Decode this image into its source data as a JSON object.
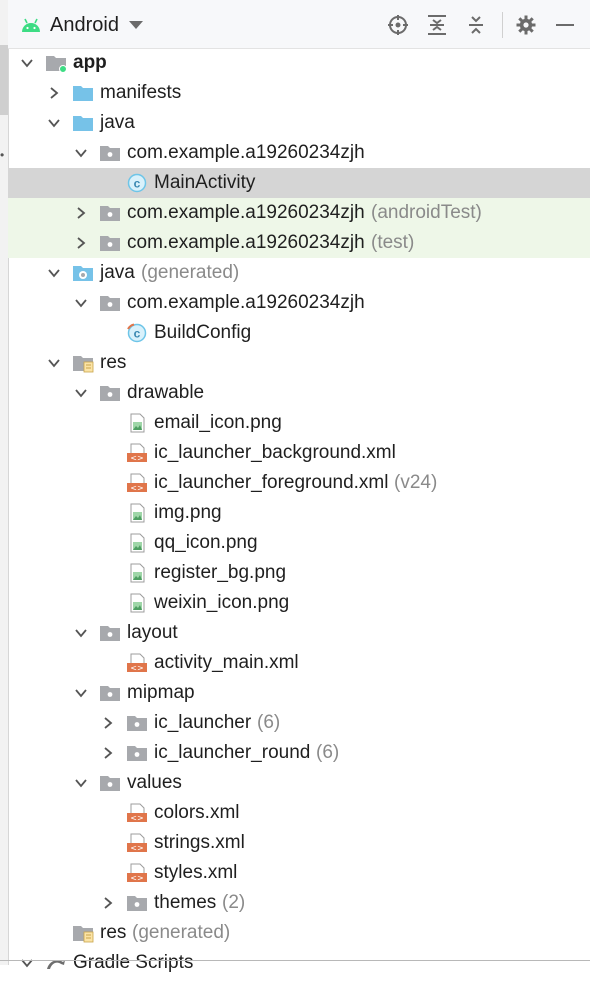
{
  "panel": {
    "view_label": "Android",
    "toolbar_icons": [
      "locate-icon",
      "expand-all-icon",
      "collapse-all-icon",
      "gear-icon",
      "minimize-icon"
    ]
  },
  "colors": {
    "folder_blue": "#76c2e8",
    "folder_gray": "#a7a9ad",
    "selected_row": "#d5d5d5",
    "test_row": "#eef7e8",
    "xml_orange": "#e0754a",
    "class_blue": "#6ec5e8",
    "android_green": "#3ddc84"
  },
  "tree": [
    {
      "indent": 0,
      "chevron": "down",
      "icon": "module-icon",
      "name": "app",
      "bold": true
    },
    {
      "indent": 1,
      "chevron": "right",
      "icon": "folder-blue-icon",
      "name": "manifests"
    },
    {
      "indent": 1,
      "chevron": "down",
      "icon": "folder-blue-icon",
      "name": "java"
    },
    {
      "indent": 2,
      "chevron": "down",
      "icon": "package-icon",
      "name": "com.example.a19260234zjh"
    },
    {
      "indent": 3,
      "chevron": "none",
      "icon": "class-icon",
      "name": "MainActivity",
      "state": "selected"
    },
    {
      "indent": 2,
      "chevron": "right",
      "icon": "package-icon",
      "name": "com.example.a19260234zjh",
      "hint": "(androidTest)",
      "state": "tested"
    },
    {
      "indent": 2,
      "chevron": "right",
      "icon": "package-icon",
      "name": "com.example.a19260234zjh",
      "hint": "(test)",
      "state": "tested"
    },
    {
      "indent": 1,
      "chevron": "down",
      "icon": "generated-folder-icon",
      "name": "java",
      "hint": "(generated)"
    },
    {
      "indent": 2,
      "chevron": "down",
      "icon": "package-icon",
      "name": "com.example.a19260234zjh"
    },
    {
      "indent": 3,
      "chevron": "none",
      "icon": "generated-class-icon",
      "name": "BuildConfig"
    },
    {
      "indent": 1,
      "chevron": "down",
      "icon": "res-folder-icon",
      "name": "res"
    },
    {
      "indent": 2,
      "chevron": "down",
      "icon": "package-icon",
      "name": "drawable"
    },
    {
      "indent": 3,
      "chevron": "none",
      "icon": "image-file-icon",
      "name": "email_icon.png"
    },
    {
      "indent": 3,
      "chevron": "none",
      "icon": "xml-file-icon",
      "name": "ic_launcher_background.xml"
    },
    {
      "indent": 3,
      "chevron": "none",
      "icon": "xml-file-icon",
      "name": "ic_launcher_foreground.xml",
      "hint": "(v24)"
    },
    {
      "indent": 3,
      "chevron": "none",
      "icon": "image-file-icon",
      "name": "img.png"
    },
    {
      "indent": 3,
      "chevron": "none",
      "icon": "image-file-icon",
      "name": "qq_icon.png"
    },
    {
      "indent": 3,
      "chevron": "none",
      "icon": "image-file-icon",
      "name": "register_bg.png"
    },
    {
      "indent": 3,
      "chevron": "none",
      "icon": "image-file-icon",
      "name": "weixin_icon.png"
    },
    {
      "indent": 2,
      "chevron": "down",
      "icon": "package-icon",
      "name": "layout"
    },
    {
      "indent": 3,
      "chevron": "none",
      "icon": "xml-file-icon",
      "name": "activity_main.xml"
    },
    {
      "indent": 2,
      "chevron": "down",
      "icon": "package-icon",
      "name": "mipmap"
    },
    {
      "indent": 3,
      "chevron": "right",
      "icon": "package-icon",
      "name": "ic_launcher",
      "hint": "(6)"
    },
    {
      "indent": 3,
      "chevron": "right",
      "icon": "package-icon",
      "name": "ic_launcher_round",
      "hint": "(6)"
    },
    {
      "indent": 2,
      "chevron": "down",
      "icon": "package-icon",
      "name": "values"
    },
    {
      "indent": 3,
      "chevron": "none",
      "icon": "xml-file-icon",
      "name": "colors.xml"
    },
    {
      "indent": 3,
      "chevron": "none",
      "icon": "xml-file-icon",
      "name": "strings.xml"
    },
    {
      "indent": 3,
      "chevron": "none",
      "icon": "xml-file-icon",
      "name": "styles.xml"
    },
    {
      "indent": 3,
      "chevron": "right",
      "icon": "package-icon",
      "name": "themes",
      "hint": "(2)"
    },
    {
      "indent": 1,
      "chevron": "none",
      "icon": "res-folder-icon",
      "name": "res",
      "hint": "(generated)"
    },
    {
      "indent": 0,
      "chevron": "down",
      "icon": "gradle-icon",
      "name": "Gradle Scripts"
    }
  ]
}
